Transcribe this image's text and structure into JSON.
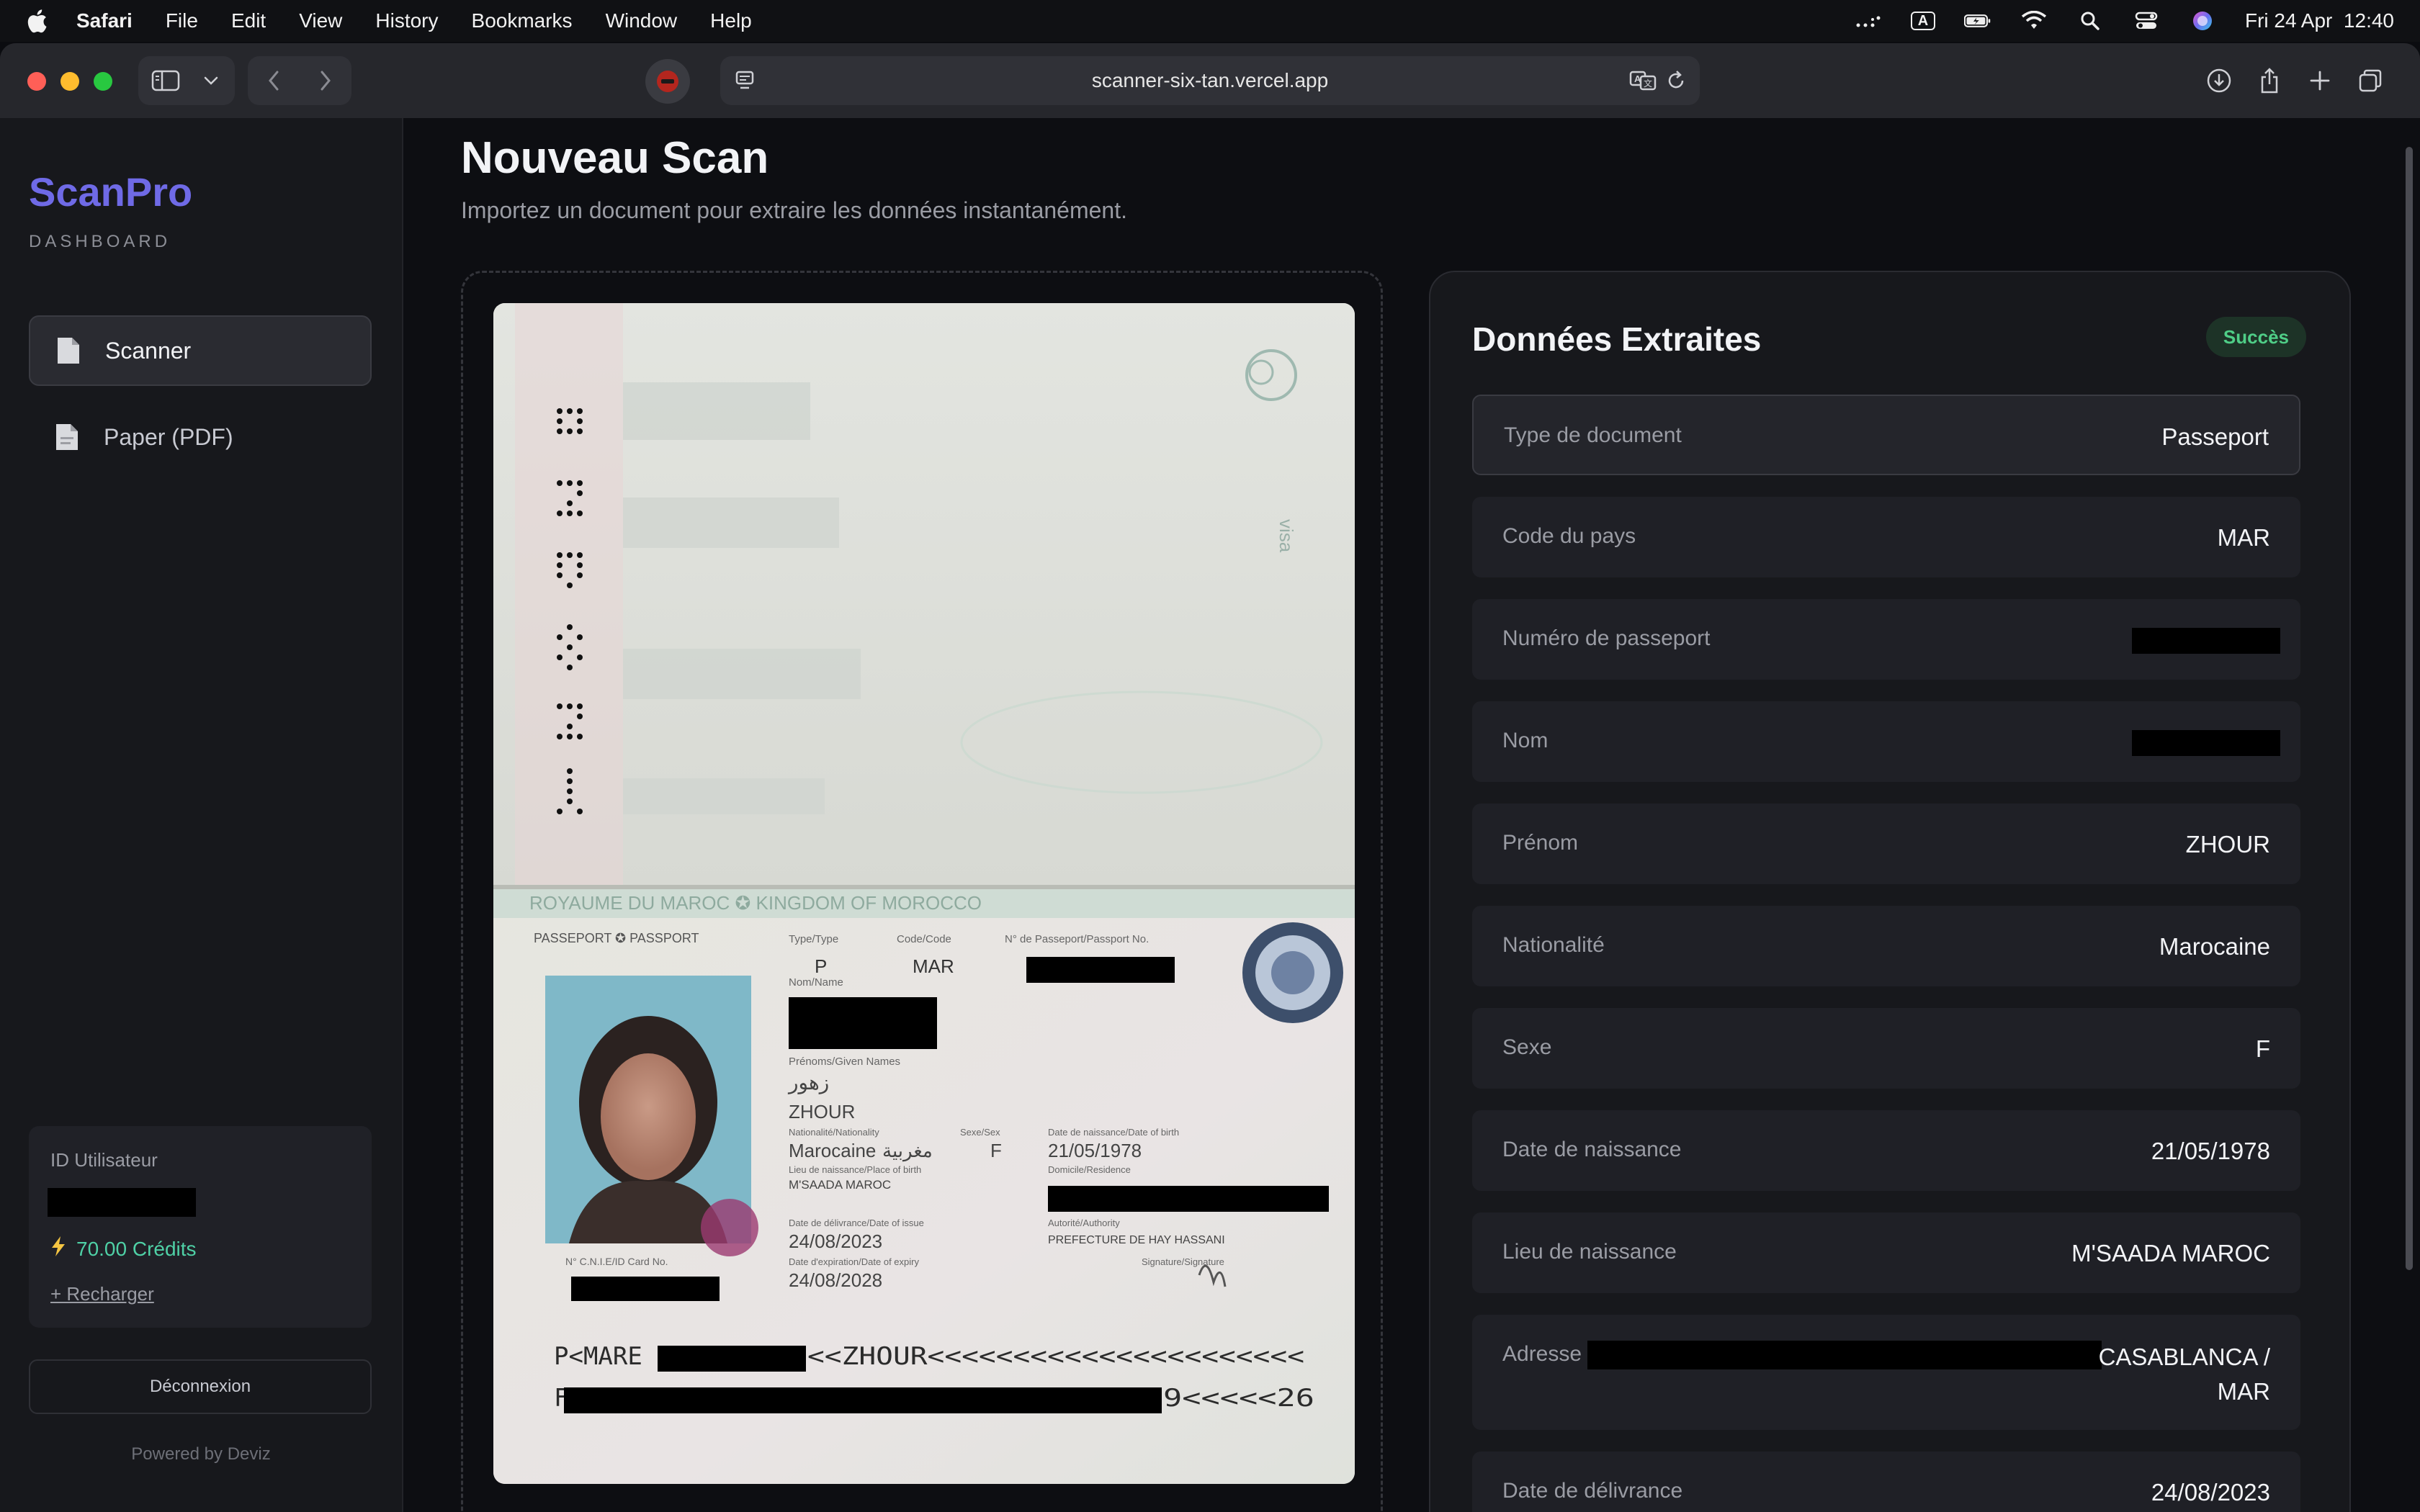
{
  "menubar": {
    "app": "Safari",
    "items": [
      "File",
      "Edit",
      "View",
      "History",
      "Bookmarks",
      "Window",
      "Help"
    ],
    "input_indicator": "A",
    "datetime": "Fri 24 Apr  12:40"
  },
  "browser": {
    "url": "scanner-six-tan.vercel.app"
  },
  "sidebar": {
    "brand": "ScanPro",
    "subtitle": "DASHBOARD",
    "nav": [
      {
        "label": "Scanner",
        "active": true
      },
      {
        "label": "Paper (PDF)",
        "active": false
      }
    ],
    "user_card": {
      "label": "ID Utilisateur",
      "credits": "70.00 Crédits",
      "recharge": "+ Recharger"
    },
    "logout": "Déconnexion",
    "powered_by": "Powered by Deviz"
  },
  "main": {
    "title": "Nouveau Scan",
    "subtitle": "Importez un document pour extraire les données instantanément."
  },
  "passport": {
    "visa_label": "visa",
    "header": "ROYAUME DU MAROC  ✪  KINGDOM OF MOROCCO",
    "passport_label": "PASSEPORT ✪ PASSPORT",
    "type_label": "Type/Type",
    "type": "P",
    "code_label": "Code/Code",
    "code": "MAR",
    "number_label": "N° de Passeport/Passport No.",
    "surname_label": "Nom/Name",
    "given_label": "Prénoms/Given Names",
    "given_arabic": "زهور",
    "given": "ZHOUR",
    "nationality_label": "Nationalité/Nationality",
    "nationality": "Marocaine",
    "nationality_arabic": "مغربية",
    "sex_label": "Sexe/Sex",
    "sex": "F",
    "dob_label": "Date de naissance/Date of birth",
    "dob": "21/05/1978",
    "pob_label": "Lieu de naissance/Place of birth",
    "pob": "M'SAADA MAROC",
    "residence_label": "Domicile/Residence",
    "issue_label": "Date de délivrance/Date of issue",
    "issue": "24/08/2023",
    "authority_label": "Autorité/Authority",
    "authority": "PREFECTURE DE HAY HASSANI",
    "expiry_label": "Date d'expiration/Date of expiry",
    "expiry": "24/08/2028",
    "signature_label": "Signature/Signature",
    "card_label": "N° C.N.I.E/ID Card No.",
    "mrz1_start": "P<MARE",
    "mrz1_end": "<<ZHOUR<<<<<<<<<<<<<<<<<<<<<<",
    "mrz2_start": "F",
    "mrz2_end": "9<<<<<26"
  },
  "results": {
    "title": "Données Extraites",
    "status": "Succès",
    "fields": [
      {
        "label": "Type de document",
        "value": "Passeport"
      },
      {
        "label": "Code du pays",
        "value": "MAR"
      },
      {
        "label": "Numéro de passeport",
        "value": ""
      },
      {
        "label": "Nom",
        "value": ""
      },
      {
        "label": "Prénom",
        "value": "ZHOUR"
      },
      {
        "label": "Nationalité",
        "value": "Marocaine"
      },
      {
        "label": "Sexe",
        "value": "F"
      },
      {
        "label": "Date de naissance",
        "value": "21/05/1978"
      },
      {
        "label": "Lieu de naissance",
        "value": "M'SAADA MAROC"
      },
      {
        "label": "Adresse",
        "value_line1": "CASABLANCA /",
        "value_line2": "MAR"
      },
      {
        "label": "Date de délivrance",
        "value": "24/08/2023"
      }
    ]
  }
}
